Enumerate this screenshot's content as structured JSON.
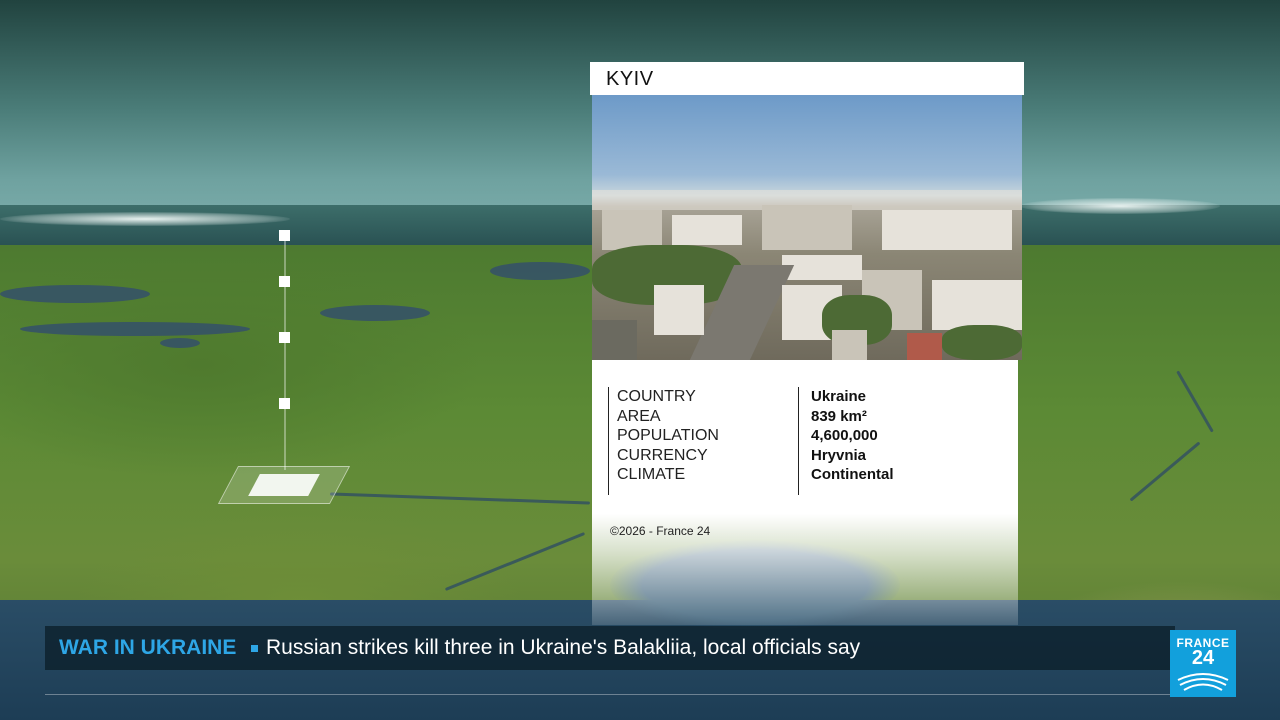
{
  "city_card": {
    "title": "KYIV",
    "labels": [
      "COUNTRY",
      "AREA",
      "POPULATION",
      "CURRENCY",
      "CLIMATE"
    ],
    "values": [
      "Ukraine",
      "839 km²",
      "4,600,000",
      "Hryvnia",
      "Continental"
    ],
    "copyright": "©2026 - France 24"
  },
  "ticker": {
    "topic": "WAR IN UKRAINE",
    "headline": "Russian strikes kill three in Ukraine's Balakliia, local officials say"
  },
  "logo": {
    "line1": "FRANCE",
    "line2": "24",
    "color": "#12a0dc"
  },
  "colors": {
    "accent": "#2ea6e6",
    "ticker_bg": "#0a1c26"
  }
}
